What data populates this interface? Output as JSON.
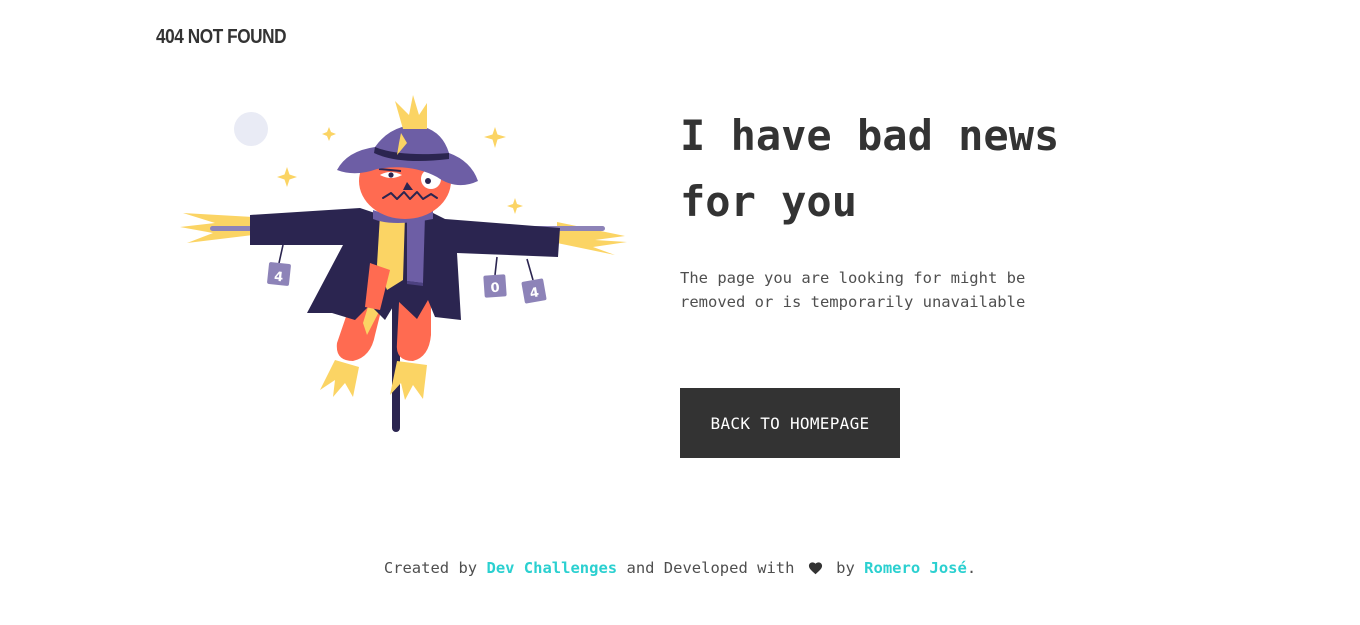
{
  "header": {
    "brand": "404 NOT FOUND"
  },
  "illustration": {
    "can_digits": [
      "4",
      "0",
      "4"
    ]
  },
  "main": {
    "headline_line1": "I have bad news",
    "headline_line2": "for you",
    "description": "The page you are looking for might be removed or is temporarily unavailable",
    "cta_label": "BACK TO HOMEPAGE"
  },
  "footer": {
    "prefix": "Created by",
    "link1": "Dev Challenges",
    "middle": "and Developed with",
    "heart_icon": "heart-icon",
    "by": "by",
    "link2": "Romero José",
    "suffix": "."
  },
  "colors": {
    "text": "#333333",
    "muted": "#4f4f4f",
    "accent": "#2bd0d0",
    "button_bg": "#333333"
  }
}
